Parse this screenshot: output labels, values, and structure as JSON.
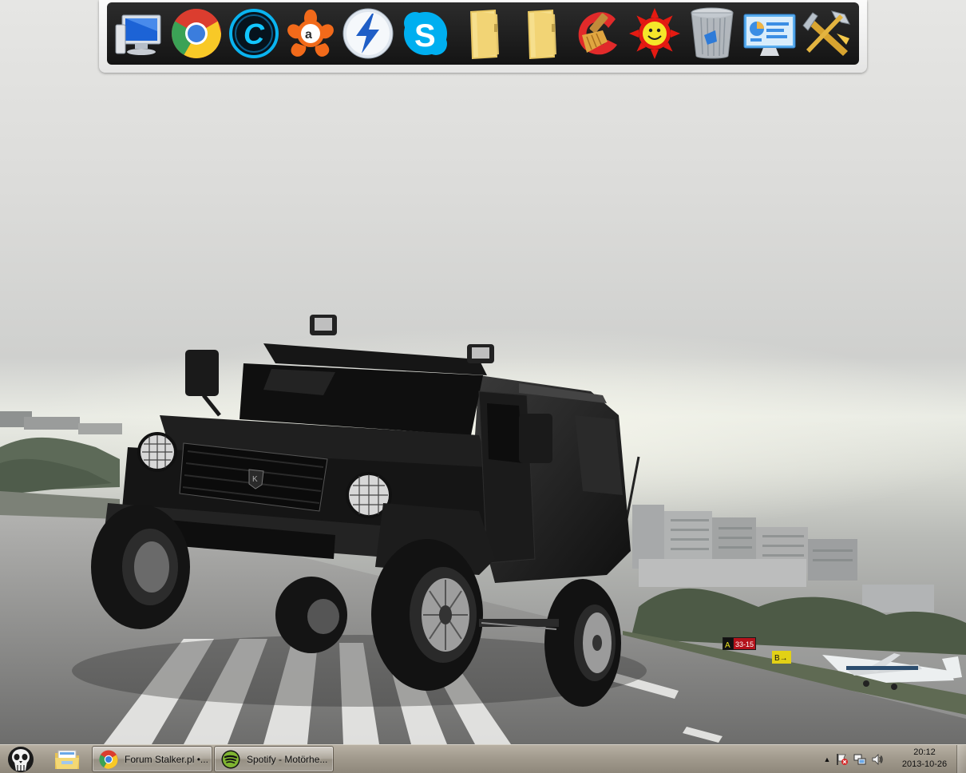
{
  "dock": {
    "icons": [
      {
        "name": "computer-icon",
        "label": "Computer"
      },
      {
        "name": "chrome-icon",
        "label": "Google Chrome"
      },
      {
        "name": "cyberlink-icon",
        "label": "C"
      },
      {
        "name": "avast-icon",
        "label": "avast!"
      },
      {
        "name": "daemon-tools-icon",
        "label": "Daemon Tools"
      },
      {
        "name": "skype-icon",
        "label": "S"
      },
      {
        "name": "folder-icon",
        "label": "Folder"
      },
      {
        "name": "folder-icon",
        "label": "Folder"
      },
      {
        "name": "ccleaner-icon",
        "label": "CCleaner"
      },
      {
        "name": "sun-smiley-icon",
        "label": "Sun"
      },
      {
        "name": "recycle-bin-icon",
        "label": "Recycle Bin"
      },
      {
        "name": "control-panel-icon",
        "label": "Control Panel"
      },
      {
        "name": "tools-icon",
        "label": "Tools"
      }
    ]
  },
  "wallpaper": {
    "sign_a": "A",
    "sign_b": "33-15",
    "sign_c": "B→",
    "grille_badge": "K"
  },
  "taskbar": {
    "tasks": [
      {
        "label": "Forum Stalker.pl •...",
        "icon": "chrome-icon"
      },
      {
        "label": "Spotify - Motörhe...",
        "icon": "spotify-icon"
      }
    ],
    "tray": {
      "arrow": "▲",
      "icons": [
        "action-center-flag-icon",
        "network-icon",
        "volume-icon"
      ]
    },
    "clock": {
      "time": "20:12",
      "date": "2013-10-26"
    }
  },
  "colors": {
    "dock_bg": "#1c1c1c",
    "taskbar_bg": "#a29b8e",
    "sky": "#dcdcda"
  }
}
